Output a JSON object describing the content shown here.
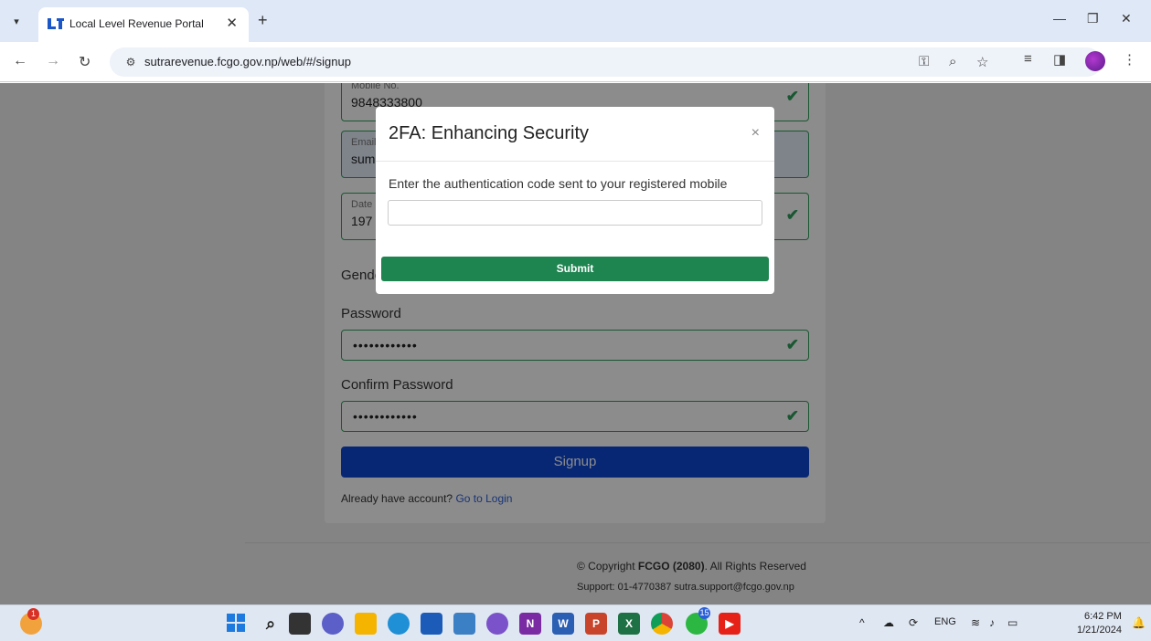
{
  "browser": {
    "tab_title": "Local Level Revenue Portal",
    "url": "sutrarevenue.fcgo.gov.np/web/#/signup"
  },
  "form": {
    "mobile_label": "Mobile No.",
    "mobile_value": "9848333800",
    "email_label": "Email",
    "email_value": "sum",
    "dob_label": "Date",
    "dob_value": "197",
    "gender_label": "Gender",
    "password_label": "Password",
    "password_value": "••••••••••••",
    "confirm_label": "Confirm Password",
    "confirm_value": "••••••••••••",
    "signup_label": "Signup",
    "have_account_text": "Already have account?",
    "login_link": "Go to Login"
  },
  "footer": {
    "copyright_prefix": "© Copyright",
    "copyright_org": "FCGO (2080)",
    "copyright_suffix": ". All Rights Reserved",
    "support": "Support: 01-4770387 sutra.support@fcgo.gov.np"
  },
  "modal": {
    "title": "2FA: Enhancing Security",
    "close": "×",
    "prompt": "Enter the authentication code sent to your registered mobile",
    "input_value": "",
    "submit_label": "Submit"
  },
  "taskbar": {
    "language": "ENG",
    "time": "6:42 PM",
    "date": "1/21/2024",
    "whatsapp_badge": "15",
    "weather_badge": "1"
  },
  "colors": {
    "accent_green": "#1e8450",
    "signup_blue": "#0d47d6",
    "valid_green": "#2f9e5b"
  }
}
